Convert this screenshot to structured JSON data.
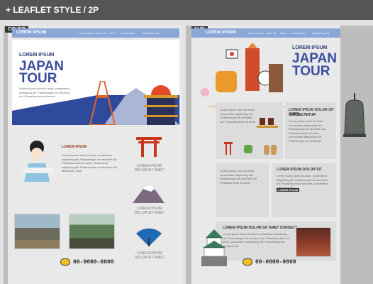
{
  "header": {
    "title": "+ LEAFLET STYLE / 2P"
  },
  "cover": {
    "tag": "COVER",
    "nav_title": "LOREM IPSUM",
    "nav_items": [
      "lorem ipsum",
      "dolor sit",
      "amet",
      "consectetur",
      "adipiscing elit"
    ],
    "heading": "LOREM IPSUM",
    "title_line1": "JAPAN",
    "title_line2": "TOUR",
    "intro": "Lorem ipsum dolor sit amet, consectetur adipiscing elit. Pellentesque se hendrerit dui. Phasellus dolor sit amet.",
    "geisha_heading": "LOREM IPSUM",
    "geisha_text": "Lorem ipsum dolor sit amet, consectetur adipiscing elit. Pellentesque se hendrerit dui. Phasellus dolor sit amet, consectetur adipiscing elit. Pellentesque se hendrerit dui. Maecenas vitae.",
    "captions": [
      "LOREM IPSUM\nDOLOR SIT AMET",
      "LOREM IPSUM\nDOLOR SIT AMET",
      "LOREM IPSUM\nDOLOR SIT AMET"
    ],
    "phone": "00-0000-0000"
  },
  "sub": {
    "tag": "SUB",
    "nav_title": "LOREM IPSUM",
    "nav_items": [
      "lorem ipsum",
      "dolor sit",
      "amet",
      "consectetur",
      "adipiscing elit"
    ],
    "heading": "LOREM IPSUM",
    "title_line1": "JAPAN",
    "title_line2": "TOUR",
    "block1_text": "Lorem ipsum dolor sit amet, consectetur adipiscing elit. Pellentesque se hendrerit dui. Phasellus dolor sit amet.",
    "block2_heading": "LOREM IPSUM DOLOR SIT AMET.",
    "block2_sub": "CONSECTETUR",
    "block2_text": "Lorem ipsum dolor sit amet, consectetur adipiscing elit. Pellentesque se hendrerit dui. Phasellus dolor sit amet, consectetur adipiscing elit. Pellentesque se hendrerit.",
    "block3_text": "Lorem ipsum dolor sit amet, consectetur adipiscing elit. Pellentesque se hendrerit dui. Phasellus dolor sit amet.",
    "block4_heading": "LOREM IPSUM DOLOR SIT",
    "block4_text": "Lorem ipsum dolor sit amet, consectetur adipiscing elit. Pellentesque se hendrerit dui. Phasellus dolor sit amet, consectetur adipiscing elit.",
    "block4_badge": "LOREM IPSUM",
    "block5_heading": "LOREM IPSUM DOLOR SIT AMET CONSECT-",
    "block5_text": "Lorem ipsum dolor sit amet, consectetur adipiscing elit. Pellentesque se hendrerit dui. Phasellus dolor sit amet, consectetur adipiscing elit. Pellentesque se hendrerit dui.",
    "phone": "00-0000-0000"
  },
  "colors": {
    "accent_blue": "#3b4da0",
    "nav_blue": "#8aa6d6",
    "accent_orange": "#9c3b21",
    "topbar": "#555555"
  }
}
